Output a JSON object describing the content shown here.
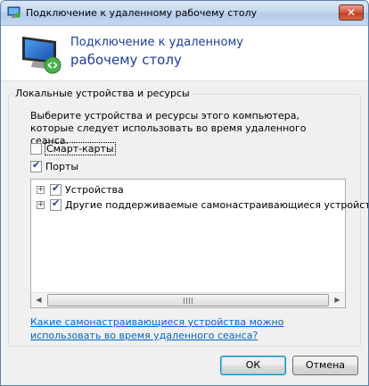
{
  "window": {
    "title": "Подключение к удаленному рабочему столу",
    "close_glyph": "✕"
  },
  "header": {
    "line1": "Подключение к удаленному",
    "line2": "рабочему столу"
  },
  "group": {
    "legend": "Локальные устройства и ресурсы",
    "description": "Выберите устройства и ресурсы этого компьютера, которые следует использовать во время удаленного сеанса.",
    "checkboxes": [
      {
        "label": "Смарт-карты",
        "checked": false
      },
      {
        "label": "Порты",
        "checked": true
      }
    ],
    "tree": [
      {
        "expander": "+",
        "label": "Устройства",
        "checked": true
      },
      {
        "expander": "+",
        "label": "Другие поддерживаемые самонастраивающиеся устройства",
        "checked": true
      }
    ],
    "scroll": {
      "left": "◀",
      "right": "▶"
    },
    "help_link": "Какие самонастраивающиеся устройства можно использовать во время удаленного сеанса?"
  },
  "buttons": {
    "ok": "ОК",
    "cancel": "Отмена"
  },
  "colors": {
    "header_text": "#1e3d99",
    "link": "#0066cc"
  }
}
